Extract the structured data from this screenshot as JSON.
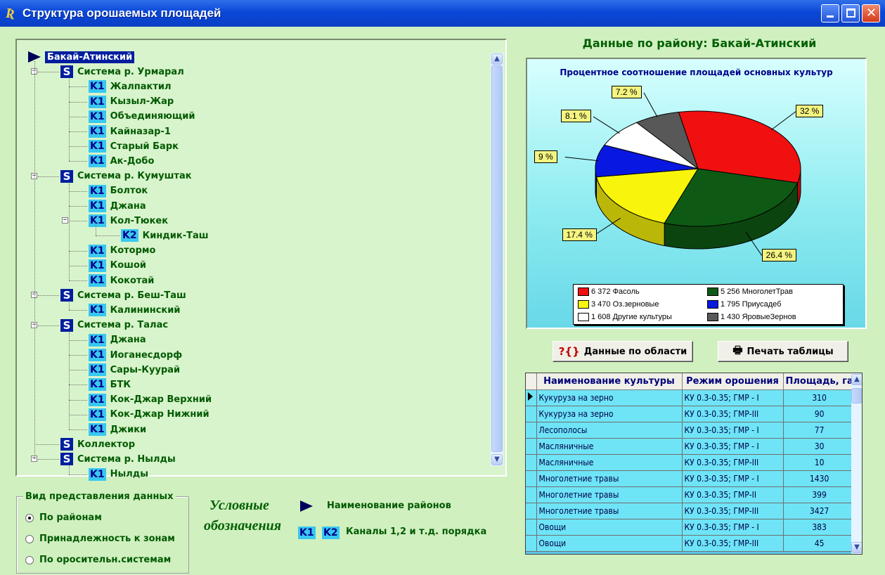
{
  "window": {
    "title": "Структура орошаемых площадей",
    "icon_text": "Ʀ"
  },
  "tree": {
    "root": "Бакай-Атинский",
    "systems": [
      {
        "badge": "S",
        "label": "Система р. Урмарал",
        "channels": [
          {
            "badge": "K1",
            "label": "Жалпактил"
          },
          {
            "badge": "K1",
            "label": "Кызыл-Жар"
          },
          {
            "badge": "K1",
            "label": "Объединяющий"
          },
          {
            "badge": "K1",
            "label": "Кайназар-1"
          },
          {
            "badge": "K1",
            "label": "Старый Барк"
          },
          {
            "badge": "K1",
            "label": "Ак-Добо"
          }
        ]
      },
      {
        "badge": "S",
        "label": "Система р. Кумуштак",
        "channels": [
          {
            "badge": "K1",
            "label": "Болток"
          },
          {
            "badge": "K1",
            "label": "Джана"
          },
          {
            "badge": "K1",
            "label": "Кол-Тюкек"
          },
          {
            "badge": "K2",
            "label": "Киндик-Таш"
          },
          {
            "badge": "K1",
            "label": "Котормо"
          },
          {
            "badge": "K1",
            "label": "Кошой"
          },
          {
            "badge": "K1",
            "label": "Кокотай"
          }
        ]
      },
      {
        "badge": "S",
        "label": "Система р. Беш-Таш",
        "channels": [
          {
            "badge": "K1",
            "label": "Калининский"
          }
        ]
      },
      {
        "badge": "S",
        "label": "Система р. Талас",
        "channels": [
          {
            "badge": "K1",
            "label": "Джана"
          },
          {
            "badge": "K1",
            "label": "Иоганесдорф"
          },
          {
            "badge": "K1",
            "label": "Сары-Куурай"
          },
          {
            "badge": "K1",
            "label": "БТК"
          },
          {
            "badge": "K1",
            "label": "Кок-Джар Верхний"
          },
          {
            "badge": "K1",
            "label": "Кок-Джар Нижний"
          },
          {
            "badge": "K1",
            "label": "Джики"
          }
        ]
      },
      {
        "badge": "S",
        "label": "Коллектор",
        "channels": []
      },
      {
        "badge": "S",
        "label": "Система р. Нылды",
        "channels": [
          {
            "badge": "K1",
            "label": "Нылды"
          }
        ]
      }
    ]
  },
  "district_heading": "Данные по району: Бакай-Атинский",
  "chart_data": {
    "type": "pie",
    "title": "Процентное соотношение площадей основных культур",
    "slices": [
      {
        "name": "Фасоль",
        "value": 6372,
        "label": "6 372 Фасоль",
        "pct_label": "32 %",
        "color": "#f01010"
      },
      {
        "name": "МноголетТрав",
        "value": 5256,
        "label": "5 256 МноголетТрав",
        "pct_label": "26.4 %",
        "color": "#0e5a14"
      },
      {
        "name": "Оз.зерновые",
        "value": 3470,
        "label": "3 470 Оз.зерновые",
        "pct_label": "17.4 %",
        "color": "#f8f40c"
      },
      {
        "name": "Приусадеб",
        "value": 1795,
        "label": "1 795 Приусадеб",
        "pct_label": "9 %",
        "color": "#0818e0"
      },
      {
        "name": "Другие культуры",
        "value": 1608,
        "label": "1 608 Другие культуры",
        "pct_label": "8.1 %",
        "color": "#ffffff"
      },
      {
        "name": "ЯровыеЗернов",
        "value": 1430,
        "label": "1 430 ЯровыеЗернов",
        "pct_label": "7.2 %",
        "color": "#585858"
      }
    ]
  },
  "buttons": {
    "region_data": "Данные по области",
    "region_icon": "?{}",
    "print": "Печать таблицы",
    "print_icon": "🖶"
  },
  "table": {
    "columns": [
      "Наименование культуры",
      "Режим орошения",
      "Площадь, га"
    ],
    "rows": [
      [
        "Кукуруза на зерно",
        "КУ 0.3-0.35; ГМР - I",
        "310"
      ],
      [
        "Кукуруза на зерно",
        "КУ 0.3-0.35; ГМР-III",
        "90"
      ],
      [
        "Лесополосы",
        "КУ 0.3-0.35; ГМР - I",
        "77"
      ],
      [
        "Масляничные",
        "КУ 0.3-0.35; ГМР - I",
        "30"
      ],
      [
        "Масляничные",
        "КУ 0.3-0.35; ГМР-III",
        "10"
      ],
      [
        "Многолетние травы",
        "КУ 0.3-0.35; ГМР - I",
        "1430"
      ],
      [
        "Многолетние травы",
        "КУ 0.3-0.35; ГМР-II",
        "399"
      ],
      [
        "Многолетние травы",
        "КУ 0.3-0.35; ГМР-III",
        "3427"
      ],
      [
        "Овощи",
        "КУ 0.3-0.35; ГМР - I",
        "383"
      ],
      [
        "Овощи",
        "КУ 0.3-0.35; ГМР-III",
        "45"
      ]
    ]
  },
  "view_group": {
    "title": "Вид представления данных",
    "options": [
      {
        "label": "По районам",
        "selected": true
      },
      {
        "label": "Принадлежность к зонам",
        "selected": false
      },
      {
        "label": "По оросительн.системам",
        "selected": false
      }
    ]
  },
  "legend_notes": {
    "title_line1": "Условные",
    "title_line2": "обозначения",
    "districts_text": "Наименование районов",
    "k1": "K1",
    "k2": "K2",
    "channels_text": "Каналы  1,2 и т.д. порядка"
  }
}
